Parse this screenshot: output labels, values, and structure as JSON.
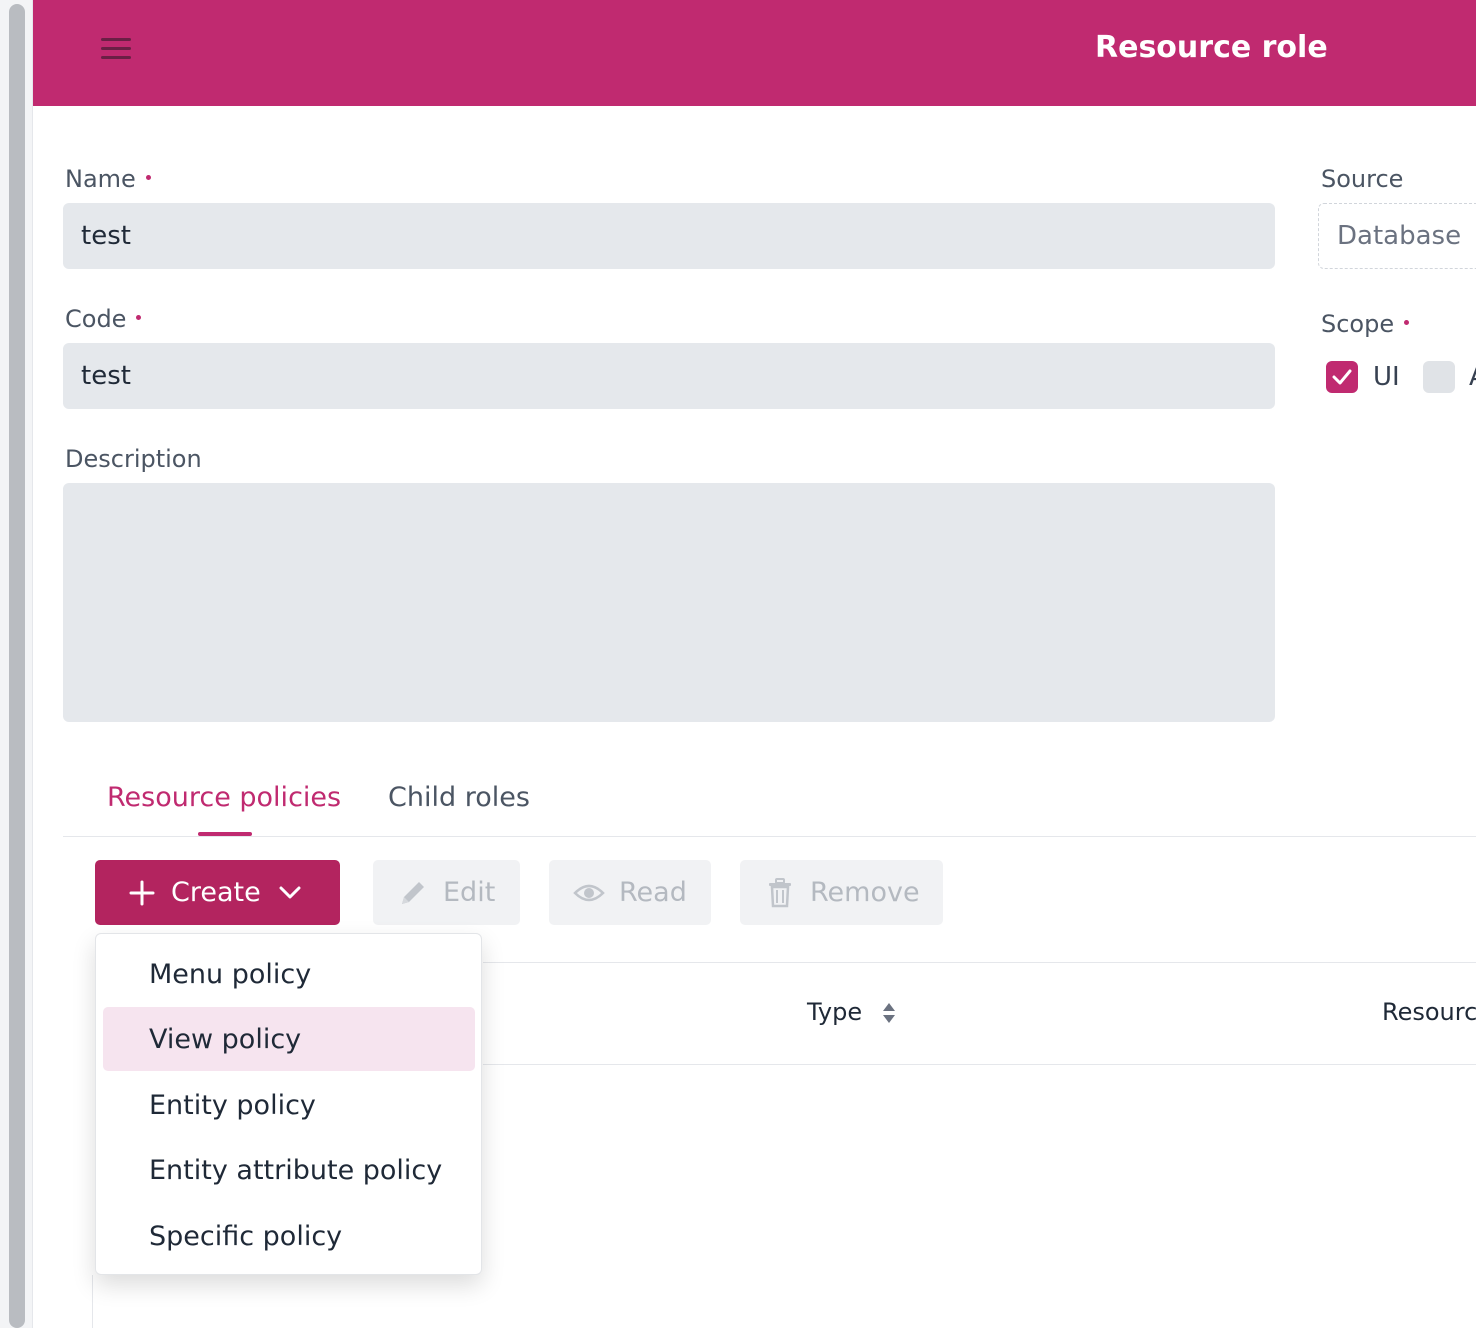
{
  "header": {
    "title": "Resource role"
  },
  "form": {
    "name": {
      "label": "Name",
      "value": "test"
    },
    "code": {
      "label": "Code",
      "value": "test"
    },
    "description": {
      "label": "Description",
      "value": ""
    },
    "source": {
      "label": "Source",
      "value": "Database"
    },
    "scope": {
      "label": "Scope",
      "options": [
        {
          "label": "UI",
          "checked": true
        },
        {
          "label": "A",
          "checked": false
        }
      ]
    }
  },
  "tabs": [
    {
      "label": "Resource policies",
      "active": true
    },
    {
      "label": "Child roles",
      "active": false
    }
  ],
  "toolbar": {
    "create_label": "Create",
    "edit_label": "Edit",
    "read_label": "Read",
    "remove_label": "Remove"
  },
  "grid": {
    "columns": [
      "Type",
      "Resourc"
    ]
  },
  "create_menu": {
    "items": [
      {
        "label": "Menu policy",
        "highlighted": false
      },
      {
        "label": "View policy",
        "highlighted": true
      },
      {
        "label": "Entity policy",
        "highlighted": false
      },
      {
        "label": "Entity attribute policy",
        "highlighted": false
      },
      {
        "label": "Specific policy",
        "highlighted": false
      }
    ]
  },
  "colors": {
    "brand": "#c02a70",
    "primary_button": "#b3245f",
    "menu_highlight": "#f6e4ef",
    "input_background": "#e5e8ec"
  }
}
